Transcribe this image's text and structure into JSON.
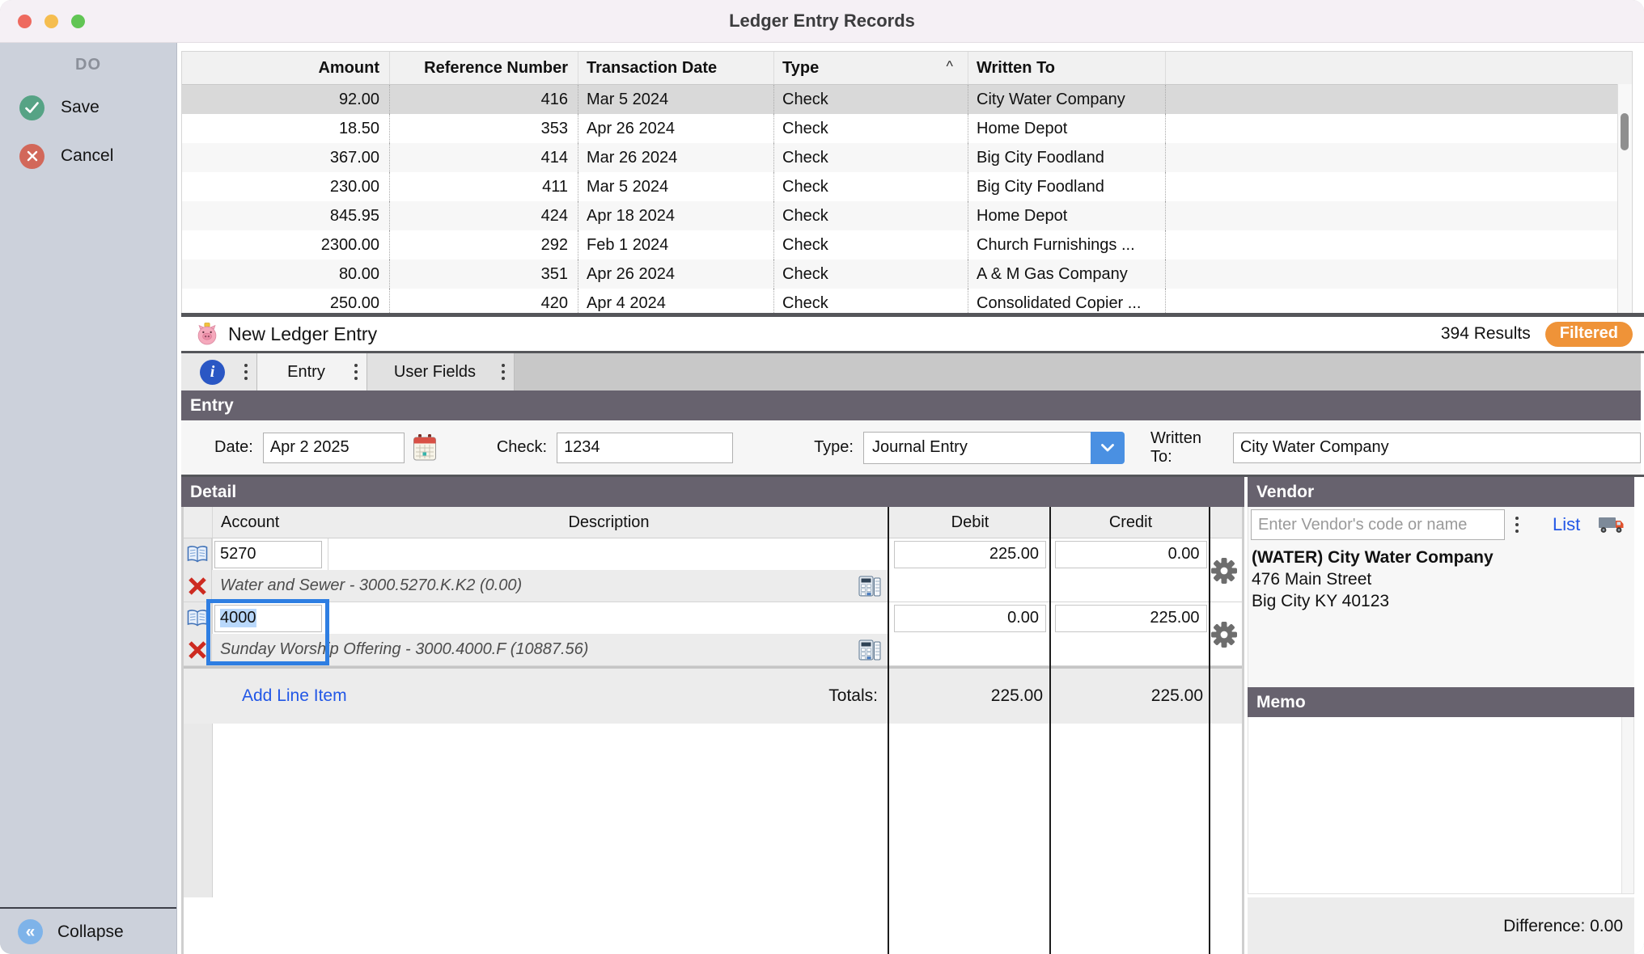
{
  "window": {
    "title": "Ledger Entry Records"
  },
  "sidebar": {
    "heading": "DO",
    "save_label": "Save",
    "cancel_label": "Cancel",
    "collapse_label": "Collapse",
    "collapse_glyph": "«"
  },
  "records": {
    "columns": {
      "amount": "Amount",
      "ref": "Reference Number",
      "date": "Transaction Date",
      "type": "Type",
      "written_to": "Written To"
    },
    "sort_indicator": "^",
    "rows": [
      {
        "amount": "92.00",
        "ref": "416",
        "date": "Mar 5 2024",
        "type": "Check",
        "written_to": "City Water Company"
      },
      {
        "amount": "18.50",
        "ref": "353",
        "date": "Apr 26 2024",
        "type": "Check",
        "written_to": "Home Depot"
      },
      {
        "amount": "367.00",
        "ref": "414",
        "date": "Mar 26 2024",
        "type": "Check",
        "written_to": "Big City Foodland"
      },
      {
        "amount": "230.00",
        "ref": "411",
        "date": "Mar 5 2024",
        "type": "Check",
        "written_to": "Big City Foodland"
      },
      {
        "amount": "845.95",
        "ref": "424",
        "date": "Apr 18 2024",
        "type": "Check",
        "written_to": "Home Depot"
      },
      {
        "amount": "2300.00",
        "ref": "292",
        "date": "Feb 1 2024",
        "type": "Check",
        "written_to": "Church Furnishings ..."
      },
      {
        "amount": "80.00",
        "ref": "351",
        "date": "Apr 26 2024",
        "type": "Check",
        "written_to": "A & M Gas Company"
      },
      {
        "amount": "250.00",
        "ref": "420",
        "date": "Apr 4 2024",
        "type": "Check",
        "written_to": "Consolidated Copier ..."
      }
    ]
  },
  "entry_header": {
    "title": "New Ledger Entry",
    "results": "394 Results",
    "filtered_badge": "Filtered"
  },
  "tabs": {
    "info_glyph": "i",
    "entry_label": "Entry",
    "user_fields_label": "User Fields"
  },
  "entry_section": {
    "heading": "Entry",
    "date_label": "Date:",
    "date_value": "Apr 2 2025",
    "check_label": "Check:",
    "check_value": "1234",
    "type_label": "Type:",
    "type_value": "Journal Entry",
    "written_to_label": "Written To:",
    "written_to_value": "City Water Company"
  },
  "detail": {
    "heading": "Detail",
    "columns": {
      "account": "Account",
      "description": "Description",
      "debit": "Debit",
      "credit": "Credit"
    },
    "line_items": [
      {
        "account": "5270",
        "info": "Water and Sewer - 3000.5270.K.K2 (0.00)",
        "debit": "225.00",
        "credit": "0.00"
      },
      {
        "account": "4000",
        "info": "Sunday Worship Offering - 3000.4000.F (10887.56)",
        "debit": "0.00",
        "credit": "225.00"
      }
    ],
    "add_line_item_label": "Add Line Item",
    "totals_label": "Totals:",
    "totals_debit": "225.00",
    "totals_credit": "225.00"
  },
  "vendor": {
    "heading": "Vendor",
    "search_placeholder": "Enter Vendor's code or name",
    "list_label": "List",
    "name": "(WATER) City Water Company",
    "address_line1": "476 Main Street",
    "address_line2": "Big City KY 40123"
  },
  "memo": {
    "heading": "Memo"
  },
  "footer": {
    "difference_label": "Difference: 0.00"
  },
  "colors": {
    "section_header": "#67626e",
    "filtered_badge": "#ef9338",
    "link_blue": "#2257e6",
    "focus_blue": "#2e7ee2",
    "save_green": "#56a385",
    "cancel_red": "#d2685a",
    "collapse_blue": "#7eb3e9",
    "dropdown_blue": "#4a90e2",
    "selected_row": "#d9d9d9"
  }
}
